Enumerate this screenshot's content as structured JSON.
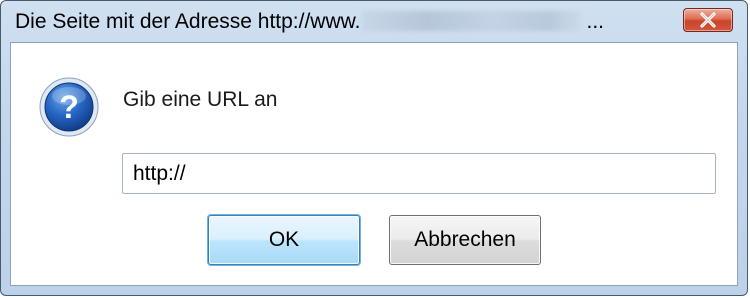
{
  "window": {
    "title_prefix": "Die Seite mit der Adresse http://www.",
    "title_ellipsis": "...",
    "close_label": "✕"
  },
  "dialog": {
    "icon": "question-icon",
    "prompt": "Gib eine URL an",
    "url_value": "http://",
    "ok_label": "OK",
    "cancel_label": "Abbrechen"
  },
  "colors": {
    "title_bar": "#c3d6ec",
    "close_button": "#d4563c",
    "question_icon": "#1e5fb4",
    "ok_border": "#3c7fb1"
  }
}
